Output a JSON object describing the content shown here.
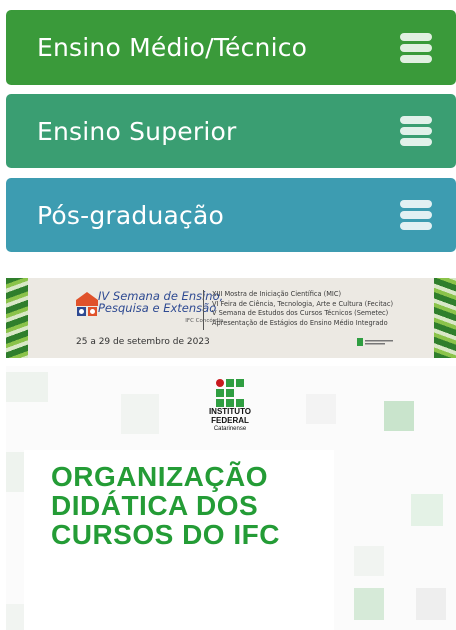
{
  "menu": {
    "items": [
      {
        "label": "Ensino Médio/Técnico",
        "color": "#3a9a3a"
      },
      {
        "label": "Ensino Superior",
        "color": "#3a9e72"
      },
      {
        "label": "Pós-graduação",
        "color": "#3d9cb1"
      }
    ],
    "menu_icon": "hamburger-menu-icon"
  },
  "event_banner": {
    "title_line1": "IV Semana de Ensino,",
    "title_line2": "Pesquisa e Extensão",
    "campus": "IFC Concórdia",
    "lines": [
      "XIII Mostra de Iniciação Científica (MIC)",
      "VI Feira de Ciência, Tecnologia, Arte e Cultura (Fecitac)",
      "V Semana de Estudos dos Cursos Técnicos (Semetec)",
      "Apresentação de Estágios do Ensino Médio Integrado"
    ],
    "date": "25 a 29 de setembro de 2023"
  },
  "poster": {
    "institution_line1": "INSTITUTO",
    "institution_line2": "FEDERAL",
    "institution_line3": "Catarinense",
    "headline": [
      "ORGANIZAÇÃO",
      "DIDÁTICA DOS",
      "CURSOS DO IFC"
    ],
    "headline_color": "#249c36"
  }
}
